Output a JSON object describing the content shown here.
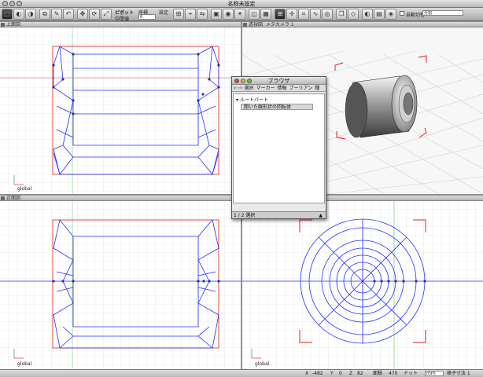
{
  "window": {
    "title": "名称未設定"
  },
  "toolbar": {
    "pivot_label": "ピボット",
    "pivot_value": "中間値",
    "coord_label": "座標",
    "coord_value": "0",
    "setting_label": "設定",
    "auto_switch_label": "自動切替",
    "auto_switch_value": "分割"
  },
  "viewports": {
    "top_left": {
      "title": "上面図",
      "axis_label": "global"
    },
    "top_right": {
      "title": "透視図",
      "camera": "メタカメラ 1"
    },
    "bottom_left": {
      "title": "正面図",
      "axis_label": "global"
    },
    "bottom_right": {
      "axis_label": "global"
    }
  },
  "browser": {
    "title": "ブラウザ",
    "menus": [
      "選択",
      "マーカー",
      "情報",
      "ブーリアン",
      "種"
    ],
    "root_item": "ルートパート",
    "child_item": "開いた線形状の回転体",
    "status": "1 / 2 選択"
  },
  "statusbar": {
    "x_label": "X",
    "x_value": "-482",
    "y_label": "Y",
    "y_value": "0",
    "z_label": "Z",
    "z_value": "82",
    "scale_label": "面積",
    "scale_value": "470",
    "unit_label": "ドット",
    "unit_value": "mm",
    "grid_label": "格子寸法 1"
  },
  "colors": {
    "profile_line": "#2233ff",
    "frame_red": "#e02020",
    "grid": "#d9d9d9",
    "axis_red": "#e06060",
    "axis_green": "#60c060"
  }
}
